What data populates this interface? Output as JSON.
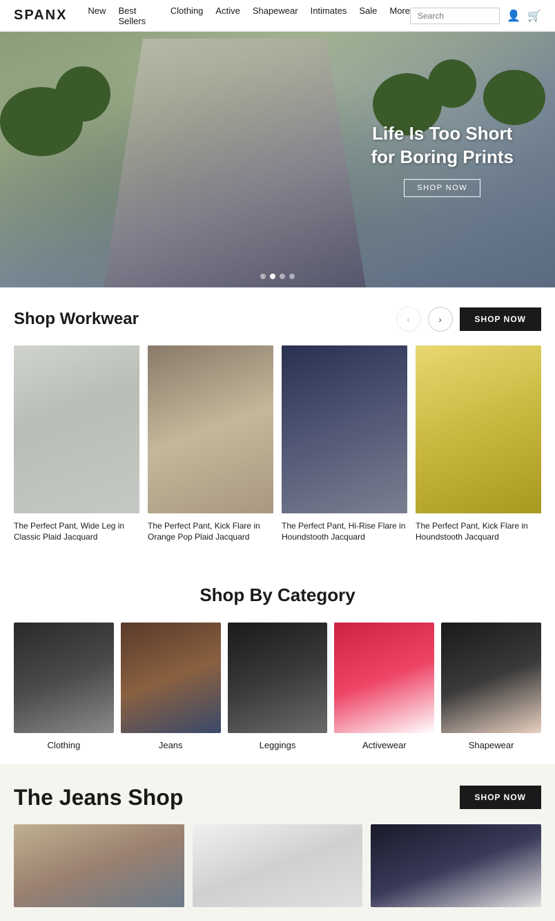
{
  "brand": {
    "name": "SPANX"
  },
  "nav": {
    "links": [
      {
        "label": "New",
        "id": "new"
      },
      {
        "label": "Best Sellers",
        "id": "best-sellers"
      },
      {
        "label": "Clothing",
        "id": "clothing"
      },
      {
        "label": "Active",
        "id": "active"
      },
      {
        "label": "Shapewear",
        "id": "shapewear"
      },
      {
        "label": "Intimates",
        "id": "intimates"
      },
      {
        "label": "Sale",
        "id": "sale"
      },
      {
        "label": "More",
        "id": "more"
      }
    ],
    "search_placeholder": "Search"
  },
  "hero": {
    "title_line1": "Life Is Too Short",
    "title_line2": "for Boring Prints",
    "cta_label": "SHOP NOW"
  },
  "workwear": {
    "section_title": "Shop Workwear",
    "shop_now_label": "SHOP NOW",
    "products": [
      {
        "name": "The Perfect Pant, Wide Leg in Classic Plaid Jacquard"
      },
      {
        "name": "The Perfect Pant, Kick Flare in Orange Pop Plaid Jacquard"
      },
      {
        "name": "The Perfect Pant, Hi-Rise Flare in Houndstooth Jacquard"
      },
      {
        "name": "The Perfect Pant, Kick Flare in Houndstooth Jacquard"
      }
    ]
  },
  "category": {
    "section_title": "Shop By Category",
    "items": [
      {
        "label": "Clothing"
      },
      {
        "label": "Jeans"
      },
      {
        "label": "Leggings"
      },
      {
        "label": "Activewear"
      },
      {
        "label": "Shapewear"
      }
    ]
  },
  "jeans": {
    "section_title": "The Jeans Shop",
    "shop_now_label": "SHOP NOW"
  },
  "icons": {
    "search": "&#128269;",
    "user": "&#128100;",
    "cart": "&#128722;",
    "left_arrow": "&#8249;",
    "right_arrow": "&#8250;"
  }
}
